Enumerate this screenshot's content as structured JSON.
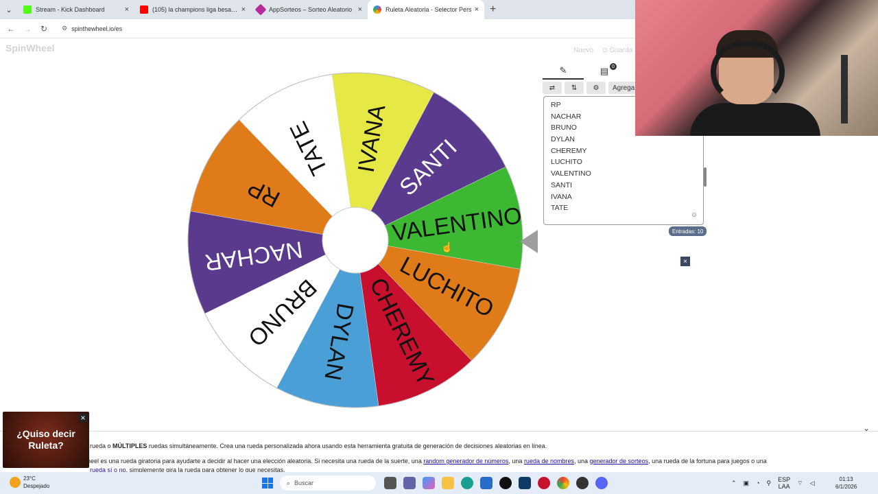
{
  "browser": {
    "tabs": [
      {
        "title": "Stream - Kick Dashboard",
        "color": "#53fc18"
      },
      {
        "title": "(105) la champions liga besame",
        "color": "#ff0000"
      },
      {
        "title": "AppSorteos – Sorteo Aleatorio",
        "color": "#b82b9c"
      },
      {
        "title": "Ruleta Aleatoria - Selector Pers",
        "color": "#4285f4"
      }
    ],
    "url": "spinthewheel.io/es"
  },
  "page": {
    "logo": "SpinWheel",
    "new_label": "Nuevo",
    "save_label": "⊙ Guarda"
  },
  "wheel": {
    "segments": [
      {
        "label": "VALENTINO",
        "color": "#3cb833"
      },
      {
        "label": "LUCHITO",
        "color": "#e07b19"
      },
      {
        "label": "CHEREMY",
        "color": "#c8102e"
      },
      {
        "label": "DYLAN",
        "color": "#4aa0d6"
      },
      {
        "label": "BRUNO",
        "color": "#ffffff"
      },
      {
        "label": "NACHAR",
        "color": "#5a3a8c"
      },
      {
        "label": "RP",
        "color": "#e07b19"
      },
      {
        "label": "TATE",
        "color": "#ffffff"
      },
      {
        "label": "IVANA",
        "color": "#e6e845"
      },
      {
        "label": "SANTI",
        "color": "#5a3a8c"
      }
    ]
  },
  "panel": {
    "tab_badge": "0",
    "add_label": "Agrega",
    "entries": [
      "RP",
      "NACHAR",
      "BRUNO",
      "DYLAN",
      "CHEREMY",
      "LUCHITO",
      "VALENTINO",
      "SANTI",
      "IVANA",
      "TATE"
    ],
    "count_label": "Entradas: 10"
  },
  "footer": {
    "line1_pre": "rueda o ",
    "line1_bold": "MÚLTIPLES",
    "line1_post": " ruedas simultáneamente. Crea una rueda personalizada ahora usando esta herramienta gratuita de generación de decisiones aleatorias en línea.",
    "line2_pre": "e Wheel es una rueda giratoria para ayudarte a decidir al hacer una elección aleatoria. Si necesita una rueda de la suerte, una ",
    "link1": "random generador de números",
    "mid1": ", una ",
    "link2": "rueda de nombres",
    "mid2": ", una ",
    "link3": "generador de sorteos",
    "line2_post": ", una rueda de la fortuna para juegos o una",
    "line3_link": "rueda sí o no",
    "line3_post": ", simplemente gira la rueda para obtener lo que necesitas."
  },
  "ad": {
    "text": "¿Quiso decir Ruleta?"
  },
  "taskbar": {
    "temp": "23°C",
    "weather": "Despejado",
    "search": "Buscar",
    "lang1": "ESP",
    "lang2": "LAA",
    "time": "01:13",
    "date": "6/1/2026"
  }
}
